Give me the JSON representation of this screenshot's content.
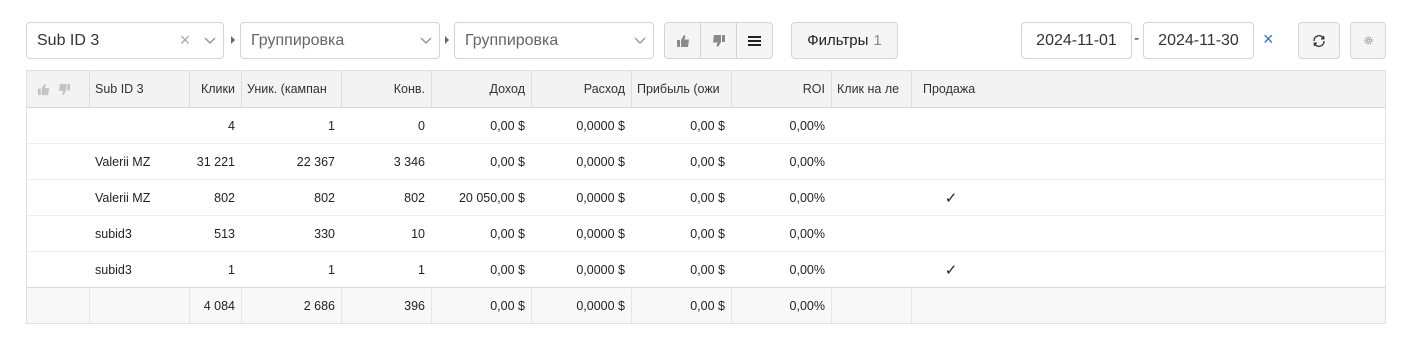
{
  "toolbar": {
    "group1": {
      "value": "Sub ID 3",
      "clear": "×"
    },
    "group2": {
      "placeholder": "Группировка"
    },
    "group3": {
      "placeholder": "Группировка"
    },
    "filters": {
      "label": "Фильтры",
      "count": "1"
    },
    "date_from": "2024-11-01",
    "date_sep": "-",
    "date_to": "2024-11-30",
    "date_clear": "×"
  },
  "table": {
    "columns": [
      "",
      "Sub ID 3",
      "Клики",
      "Уник. (кампан",
      "Конв.",
      "Доход",
      "Расход",
      "Прибыль (ожи",
      "ROI",
      "Клик на ле",
      "Продажа"
    ],
    "rows": [
      {
        "sub": "",
        "clicks": "4",
        "uniq": "1",
        "conv": "0",
        "income": "0,00 $",
        "cost": "0,0000 $",
        "profit": "0,00 $",
        "roi": "0,00%",
        "lp": "",
        "sale": ""
      },
      {
        "sub": "Valerii MZ",
        "clicks": "31 221",
        "uniq": "22 367",
        "conv": "3 346",
        "income": "0,00 $",
        "cost": "0,0000 $",
        "profit": "0,00 $",
        "roi": "0,00%",
        "lp": "",
        "sale": ""
      },
      {
        "sub": "Valerii MZ",
        "clicks": "802",
        "uniq": "802",
        "conv": "802",
        "income": "20 050,00 $",
        "cost": "0,0000 $",
        "profit": "0,00 $",
        "roi": "0,00%",
        "lp": "",
        "sale": "✓"
      },
      {
        "sub": "subid3",
        "clicks": "513",
        "uniq": "330",
        "conv": "10",
        "income": "0,00 $",
        "cost": "0,0000 $",
        "profit": "0,00 $",
        "roi": "0,00%",
        "lp": "",
        "sale": ""
      },
      {
        "sub": "subid3",
        "clicks": "1",
        "uniq": "1",
        "conv": "1",
        "income": "0,00 $",
        "cost": "0,0000 $",
        "profit": "0,00 $",
        "roi": "0,00%",
        "lp": "",
        "sale": "✓"
      }
    ],
    "totals": {
      "clicks": "4 084",
      "uniq": "2 686",
      "conv": "396",
      "income": "0,00 $",
      "cost": "0,0000 $",
      "profit": "0,00 $",
      "roi": "0,00%"
    }
  }
}
